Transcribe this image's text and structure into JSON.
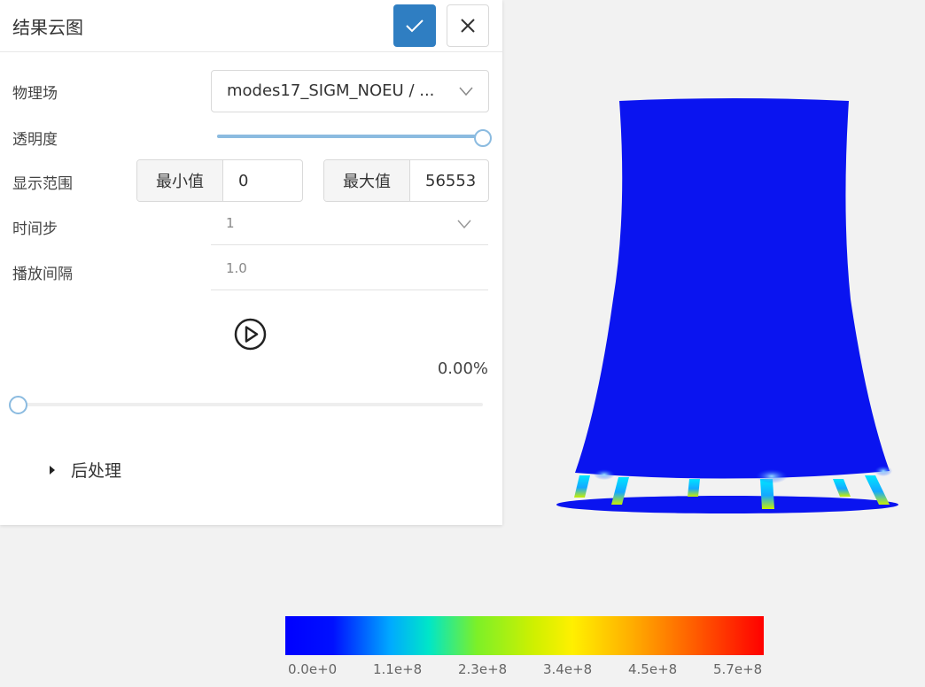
{
  "panel": {
    "title": "结果云图",
    "confirm_icon": "check-icon",
    "close_icon": "close-icon"
  },
  "physics_field": {
    "label": "物理场",
    "value": "modes17_SIGM_NOEU / ..."
  },
  "transparency": {
    "label": "透明度",
    "level": 1.0
  },
  "display_range": {
    "label": "显示范围",
    "min_label": "最小值",
    "min_value": "0",
    "max_label": "最大值",
    "max_value": "56553"
  },
  "time_step": {
    "label": "时间步",
    "value": "1"
  },
  "play_interval": {
    "label": "播放间隔",
    "value": "1.0"
  },
  "playback": {
    "percent": "0.00%",
    "progress": 0.0
  },
  "post_processing": {
    "label": "后处理"
  },
  "colorbar": {
    "colors": [
      "#0000ff",
      "#00aaff",
      "#00e6c8",
      "#cff000",
      "#fff000",
      "#ffb000",
      "#ff0000"
    ],
    "ticks": [
      "0.0e+0",
      "1.1e+8",
      "2.3e+8",
      "3.4e+8",
      "4.5e+8",
      "5.7e+8"
    ]
  },
  "colors": {
    "accent": "#2f7ec2",
    "slider_fill": "#8bbbe0",
    "model_primary": "#0a14f0"
  }
}
